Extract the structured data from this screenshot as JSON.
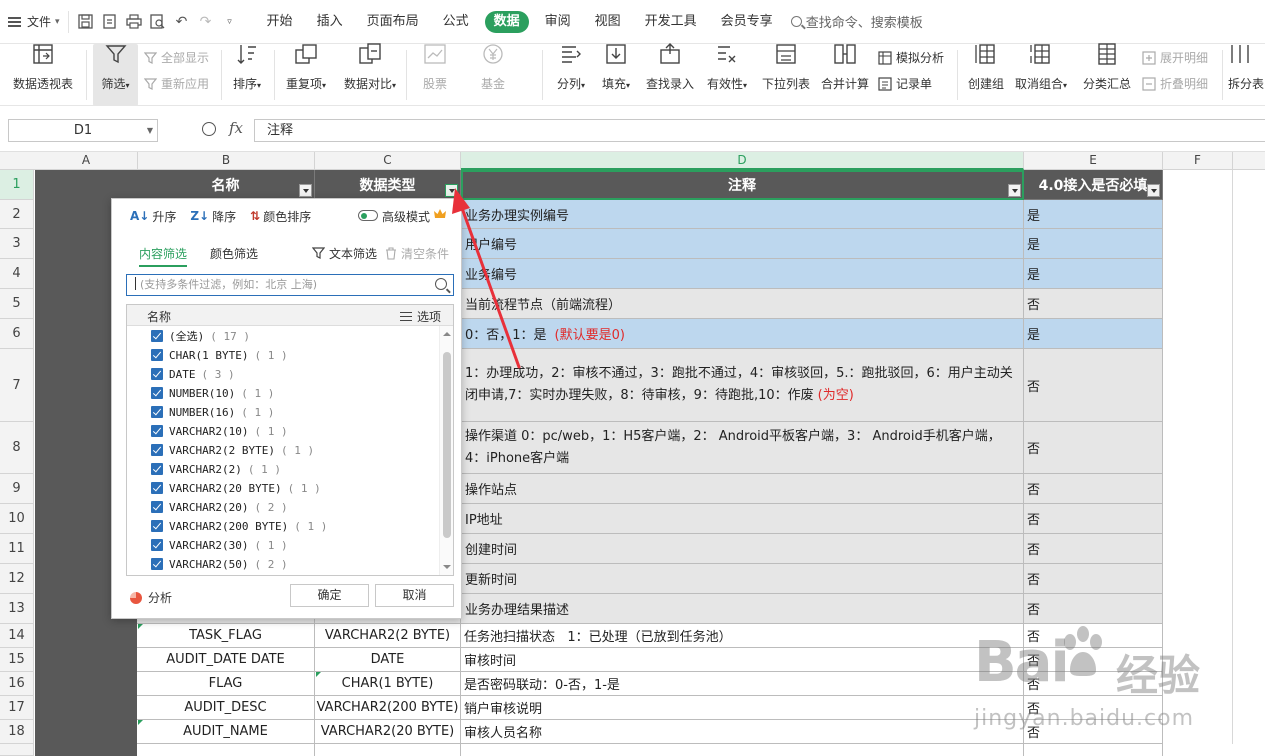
{
  "menu": {
    "file": "文件",
    "tabs": [
      "开始",
      "插入",
      "页面布局",
      "公式",
      "数据",
      "审阅",
      "视图",
      "开发工具",
      "会员专享"
    ],
    "active_tab_index": 4,
    "search": "查找命令、搜索模板"
  },
  "ribbon": {
    "pivot": "数据透视表",
    "filter": "筛选",
    "show_all": "全部显示",
    "reapply": "重新应用",
    "sort": "排序",
    "duplicates": "重复项",
    "compare": "数据对比",
    "stock": "股票",
    "fund": "基金",
    "split": "分列",
    "fill": "填充",
    "lookup": "查找录入",
    "validity": "有效性",
    "dropdown": "下拉列表",
    "consolidate": "合并计算",
    "simulate": "模拟分析",
    "record": "记录单",
    "group": "创建组",
    "ungroup": "取消组合",
    "subtotal": "分类汇总",
    "expand": "展开明细",
    "collapse": "折叠明细",
    "split_table": "拆分表"
  },
  "formula_bar": {
    "cell_ref": "D1",
    "fx": "fx",
    "content": "注释"
  },
  "columns": [
    "A",
    "B",
    "C",
    "D",
    "E",
    "F"
  ],
  "rows": [
    "1",
    "2",
    "3",
    "4",
    "5",
    "6",
    "7",
    "8",
    "9",
    "10",
    "11",
    "12",
    "13",
    "14",
    "15",
    "16",
    "17",
    "18"
  ],
  "table": {
    "headers": [
      "名称",
      "数据类型",
      "注释",
      "4.0接入是否必填"
    ],
    "d2": "业务办理实例编号",
    "d3": "用户编号",
    "d4": "业务编号",
    "d5": "当前流程节点（前端流程）",
    "d6a": "0：否，1：是",
    "d6b": "(默认要是0)",
    "d7a": "1：办理成功，2：审核不通过，3：跑批不通过，4：审核驳回，5.：跑批驳回，6：用户主动关闭申请,7：实时办理失败，8：待审核，9：待跑批,10：作废",
    "d7b": "(为空)",
    "d8": "操作渠道 0：pc/web，1：H5客户端，2： Android平板客户端，3： Android手机客户端，4：iPhone客户端",
    "d9": "操作站点",
    "d10": "IP地址",
    "d11": "创建时间",
    "d12": "更新时间",
    "d13": "业务办理结果描述",
    "e": [
      "是",
      "是",
      "是",
      "否",
      "是",
      "否",
      "否",
      "否",
      "否",
      "否",
      "否",
      "否",
      "否",
      "否",
      "否",
      "否",
      "否"
    ],
    "r14": [
      "TASK_FLAG",
      "VARCHAR2(2 BYTE)",
      "任务池扫描状态   1：已处理（已放到任务池）"
    ],
    "r15": [
      "AUDIT_DATE DATE",
      "DATE",
      "审核时间"
    ],
    "r16": [
      "FLAG",
      "CHAR(1 BYTE)",
      "是否密码联动：0-否，1-是"
    ],
    "r17": [
      "AUDIT_DESC",
      "VARCHAR2(200 BYTE)",
      "销户审核说明"
    ],
    "r18": [
      "AUDIT_NAME",
      "VARCHAR2(20 BYTE)",
      "审核人员名称"
    ]
  },
  "filter_popup": {
    "asc": "升序",
    "desc": "降序",
    "color_sort": "颜色排序",
    "advanced": "高级模式",
    "tab_content": "内容筛选",
    "tab_color": "颜色筛选",
    "text_filter": "文本筛选",
    "clear": "清空条件",
    "search_placeholder": "(支持多条件过滤，例如：北京 上海)",
    "list_header": "名称",
    "options": "选项",
    "items": [
      {
        "label": "(全选)",
        "count": "( 17 )"
      },
      {
        "label": "CHAR(1 BYTE)",
        "count": "( 1 )"
      },
      {
        "label": "DATE",
        "count": "( 3 )"
      },
      {
        "label": "NUMBER(10)",
        "count": "( 1 )"
      },
      {
        "label": "NUMBER(16)",
        "count": "( 1 )"
      },
      {
        "label": "VARCHAR2(10)",
        "count": "( 1 )"
      },
      {
        "label": "VARCHAR2(2 BYTE)",
        "count": "( 1 )"
      },
      {
        "label": "VARCHAR2(2)",
        "count": "( 1 )"
      },
      {
        "label": "VARCHAR2(20 BYTE)",
        "count": "( 1 )"
      },
      {
        "label": "VARCHAR2(20)",
        "count": "( 2 )"
      },
      {
        "label": "VARCHAR2(200 BYTE)",
        "count": "( 1 )"
      },
      {
        "label": "VARCHAR2(30)",
        "count": "( 1 )"
      },
      {
        "label": "VARCHAR2(50)",
        "count": "( 2 )"
      }
    ],
    "analyze": "分析",
    "ok": "确定",
    "cancel": "取消"
  },
  "watermark": {
    "brand": "Bai",
    "suffix": "经验",
    "url": "jingyan.baidu.com"
  },
  "colors": {
    "accent": "#2b9f5e",
    "header_bg": "#595959",
    "row_blue": "#bdd7ee",
    "row_gray": "#e6e6e6",
    "arrow": "#e8303a"
  }
}
